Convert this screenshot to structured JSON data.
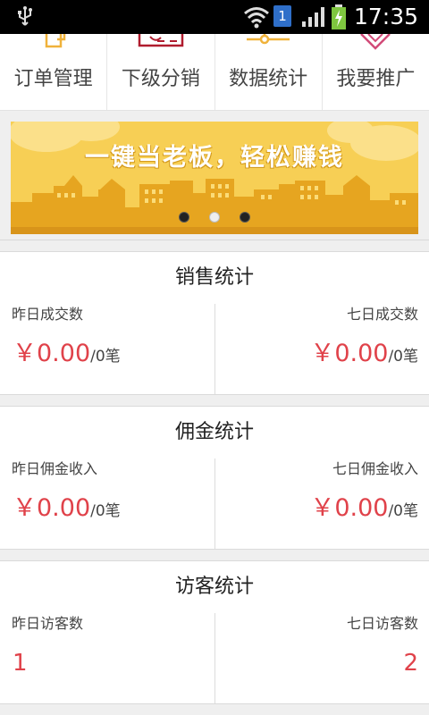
{
  "status_bar": {
    "time": "17:35",
    "sim_slot": "1",
    "icons": [
      "usb-icon",
      "wifi-icon",
      "sim-icon",
      "signal-icon",
      "battery-charging-icon"
    ]
  },
  "top_nav": {
    "items": [
      {
        "label": "订单管理",
        "icon": "order-icon"
      },
      {
        "label": "下级分销",
        "icon": "distribution-icon"
      },
      {
        "label": "数据统计",
        "icon": "statistics-icon"
      },
      {
        "label": "我要推广",
        "icon": "promote-icon"
      }
    ]
  },
  "banner": {
    "slogan": "一键当老板，轻松赚钱",
    "slide_count": 3,
    "active_slide": 2,
    "colors": {
      "background": "#f7cf55",
      "buildings": "#e6a520"
    }
  },
  "sales_stats": {
    "title": "销售统计",
    "left": {
      "label": "昨日成交数",
      "amount": "￥0.00",
      "count": "/0笔"
    },
    "right": {
      "label": "七日成交数",
      "amount": "￥0.00",
      "count": "/0笔"
    }
  },
  "commission_stats": {
    "title": "佣金统计",
    "left": {
      "label": "昨日佣金收入",
      "amount": "￥0.00",
      "count": "/0笔"
    },
    "right": {
      "label": "七日佣金收入",
      "amount": "￥0.00",
      "count": "/0笔"
    }
  },
  "visitor_stats": {
    "title": "访客统计",
    "left": {
      "label": "昨日访客数",
      "value": "1"
    },
    "right": {
      "label": "七日访客数",
      "value": "2"
    }
  },
  "colors": {
    "accent_red": "#e0424a",
    "page_bg": "#efefef"
  }
}
